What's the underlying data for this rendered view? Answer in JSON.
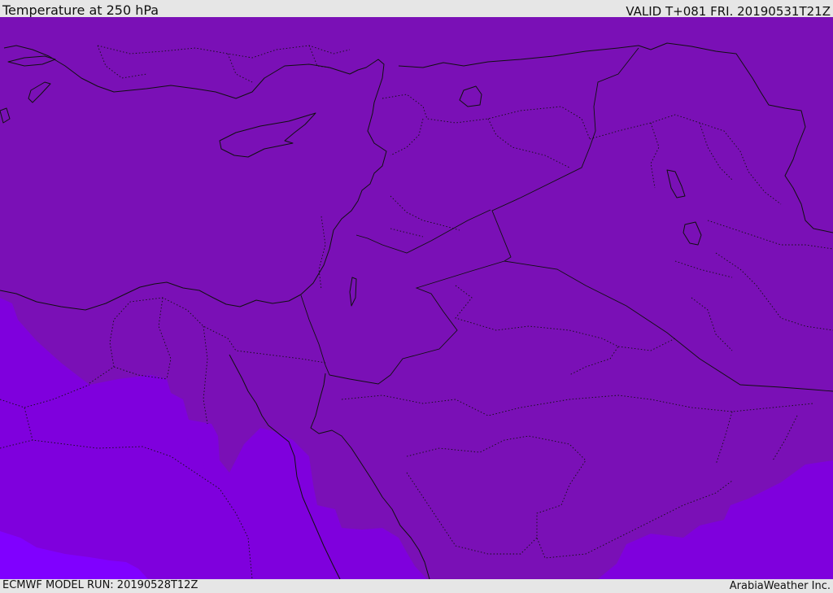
{
  "header": {
    "title": "Temperature at 250 hPa",
    "valid_time": "VALID T+081 FRI. 20190531T21Z"
  },
  "footer": {
    "model_run": "ECMWF MODEL RUN: 20190528T12Z",
    "credit": "ArabiaWeather Inc."
  },
  "map": {
    "colors": {
      "band_main": "#7a10b6",
      "band_cool": "#7f00dd",
      "band_cold": "#8000ff",
      "lines": "#101010"
    }
  }
}
